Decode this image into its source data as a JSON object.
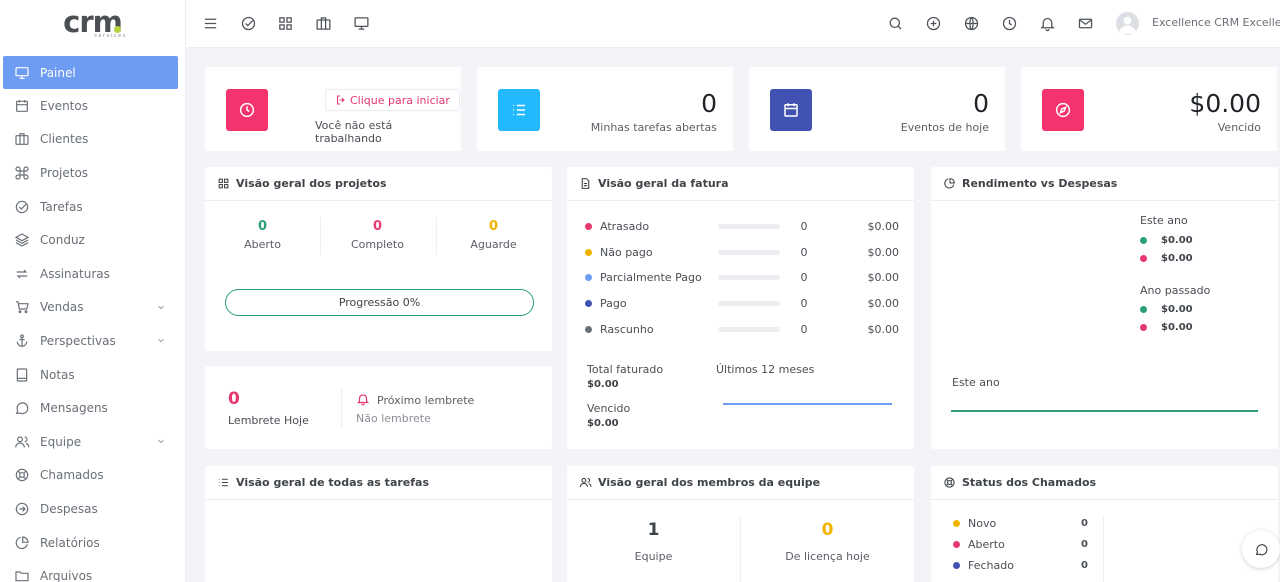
{
  "logo": {
    "text": "crm",
    "sub": "services"
  },
  "sidebar": {
    "items": [
      {
        "label": "Painel",
        "icon": "monitor-icon"
      },
      {
        "label": "Eventos",
        "icon": "calendar-icon"
      },
      {
        "label": "Clientes",
        "icon": "briefcase-icon"
      },
      {
        "label": "Projetos",
        "icon": "command-icon"
      },
      {
        "label": "Tarefas",
        "icon": "check-circle-icon"
      },
      {
        "label": "Conduz",
        "icon": "layers-icon"
      },
      {
        "label": "Assinaturas",
        "icon": "repeat-icon"
      },
      {
        "label": "Vendas",
        "icon": "cart-icon"
      },
      {
        "label": "Perspectivas",
        "icon": "anchor-icon"
      },
      {
        "label": "Notas",
        "icon": "book-icon"
      },
      {
        "label": "Mensagens",
        "icon": "message-icon"
      },
      {
        "label": "Equipe",
        "icon": "users-icon"
      },
      {
        "label": "Chamados",
        "icon": "life-buoy-icon"
      },
      {
        "label": "Despesas",
        "icon": "arrow-circle-icon"
      },
      {
        "label": "Relatórios",
        "icon": "pie-chart-icon"
      },
      {
        "label": "Arquivos",
        "icon": "folder-icon"
      }
    ]
  },
  "topbar": {
    "user_name": "Excellence CRM Excellence"
  },
  "clock": {
    "button": "Clique para iniciar",
    "note": "Você não está trabalhando"
  },
  "stats": [
    {
      "value": "0",
      "label": "Minhas tarefas abertas",
      "color": "#22b9ff",
      "icon": "list-icon"
    },
    {
      "value": "0",
      "label": "Eventos de hoje",
      "color": "#4252b2",
      "icon": "calendar-icon"
    },
    {
      "value": "$0.00",
      "label": "Vencido",
      "color": "#f5336e",
      "icon": "compass-icon"
    }
  ],
  "projects": {
    "title": "Visão geral dos projetos",
    "open": {
      "value": "0",
      "label": "Aberto",
      "color": "#2c9f78"
    },
    "done": {
      "value": "0",
      "label": "Completo",
      "color": "#e5386d"
    },
    "hold": {
      "value": "0",
      "label": "Aguarde",
      "color": "#f0b400"
    },
    "progress": "Progressão 0%"
  },
  "reminder": {
    "value": "0",
    "label": "Lembrete Hoje",
    "next": "Próximo lembrete",
    "none": "Não lembrete"
  },
  "invoice": {
    "title": "Visão geral da fatura",
    "rows": [
      {
        "label": "Atrasado",
        "count": "0",
        "amount": "$0.00",
        "color": "#e5386d"
      },
      {
        "label": "Não pago",
        "count": "0",
        "amount": "$0.00",
        "color": "#f0b400"
      },
      {
        "label": "Parcialmente Pago",
        "count": "0",
        "amount": "$0.00",
        "color": "#6d9cf2"
      },
      {
        "label": "Pago",
        "count": "0",
        "amount": "$0.00",
        "color": "#4252b2"
      },
      {
        "label": "Rascunho",
        "count": "0",
        "amount": "$0.00",
        "color": "#6a7078"
      }
    ],
    "total_label": "Total faturado",
    "total_value": "$0.00",
    "due_label": "Vencido",
    "due_value": "$0.00",
    "period": "Últimos 12 meses"
  },
  "income": {
    "title": "Rendimento vs Despesas",
    "this_year": "Este ano",
    "this_year_values": [
      "$0.00",
      "$0.00"
    ],
    "last_year": "Ano passado",
    "last_year_values": [
      "$0.00",
      "$0.00"
    ],
    "chart_label": "Este ano",
    "income_color": "#2c9f78",
    "expense_color": "#e5386d"
  },
  "all_tasks": {
    "title": "Visão geral de todas as tarefas"
  },
  "team": {
    "title": "Visão geral dos membros da equipe",
    "members": {
      "value": "1",
      "label": "Equipe"
    },
    "leave": {
      "value": "0",
      "label": "De licença hoje"
    }
  },
  "tickets": {
    "title": "Status dos Chamados",
    "rows": [
      {
        "label": "Novo",
        "count": "0",
        "color": "#f0b400"
      },
      {
        "label": "Aberto",
        "count": "0",
        "color": "#e5386d"
      },
      {
        "label": "Fechado",
        "count": "0",
        "color": "#4252b2"
      }
    ]
  }
}
